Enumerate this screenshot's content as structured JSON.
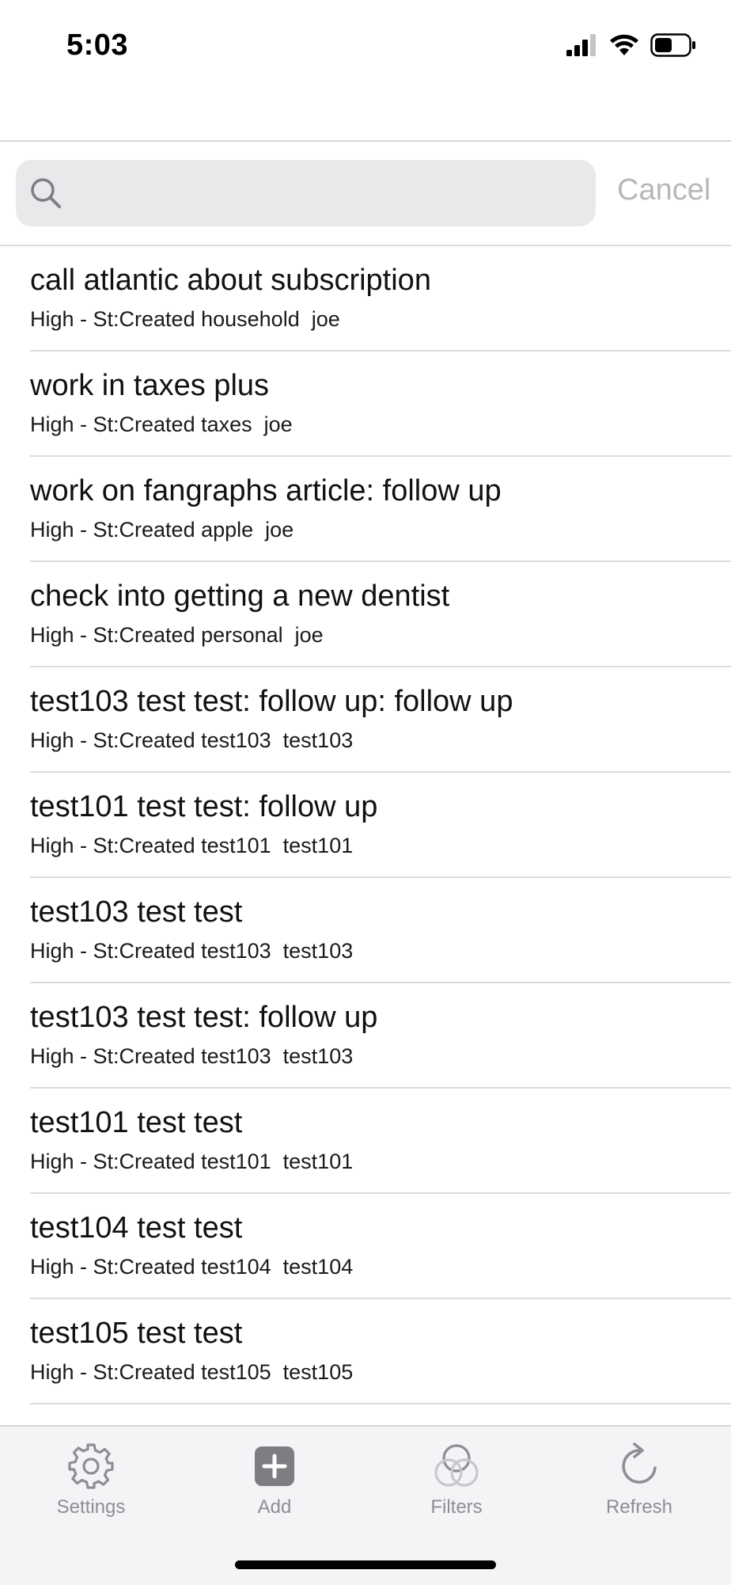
{
  "status_bar": {
    "time": "5:03",
    "icons": [
      "cellular-signal-icon",
      "wifi-icon",
      "battery-icon"
    ]
  },
  "search": {
    "placeholder": "",
    "value": "",
    "cancel_label": "Cancel"
  },
  "tasks": [
    {
      "title": "call atlantic about subscription",
      "subtitle": "High - St:Created household  joe"
    },
    {
      "title": "work in taxes plus",
      "subtitle": "High - St:Created taxes  joe"
    },
    {
      "title": "work on fangraphs article: follow up",
      "subtitle": "High - St:Created apple  joe"
    },
    {
      "title": "check into getting a new dentist",
      "subtitle": "High - St:Created personal  joe"
    },
    {
      "title": "test103 test test: follow up: follow up",
      "subtitle": "High - St:Created test103  test103"
    },
    {
      "title": "test101 test test: follow up",
      "subtitle": "High - St:Created test101  test101"
    },
    {
      "title": "test103 test test",
      "subtitle": "High - St:Created test103  test103"
    },
    {
      "title": "test103 test test: follow up",
      "subtitle": "High - St:Created test103  test103"
    },
    {
      "title": "test101 test test",
      "subtitle": "High - St:Created test101  test101"
    },
    {
      "title": "test104 test test",
      "subtitle": "High - St:Created test104  test104"
    },
    {
      "title": "test105 test test",
      "subtitle": "High - St:Created test105  test105"
    }
  ],
  "tab_bar": {
    "items": [
      {
        "label": "Settings",
        "icon": "gear-icon"
      },
      {
        "label": "Add",
        "icon": "plus-square-icon"
      },
      {
        "label": "Filters",
        "icon": "filters-circles-icon"
      },
      {
        "label": "Refresh",
        "icon": "refresh-icon"
      }
    ]
  },
  "colors": {
    "tab_icon": "#8e8e93",
    "search_bg": "#e9e9eb",
    "cancel_text": "#b8b8bc",
    "separator": "#dcdcde"
  }
}
